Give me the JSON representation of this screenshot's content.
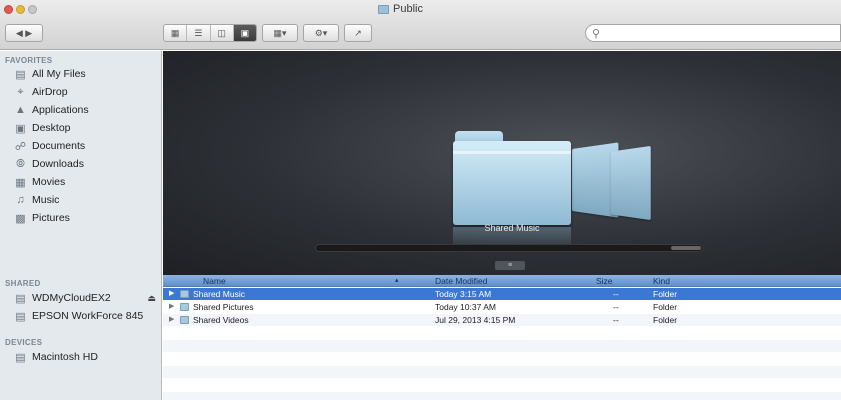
{
  "window": {
    "title": "Public"
  },
  "toolbar": {
    "back_icon": "back-arrow-icon",
    "forward_icon": "forward-arrow-icon",
    "view_buttons": [
      "icon-view",
      "list-view",
      "column-view",
      "cover-flow-view"
    ],
    "search_placeholder": ""
  },
  "sidebar": {
    "favorites_header": "FAVORITES",
    "favorites": [
      {
        "label": "All My Files",
        "icon": "all-files-icon"
      },
      {
        "label": "AirDrop",
        "icon": "airdrop-icon"
      },
      {
        "label": "Applications",
        "icon": "applications-icon"
      },
      {
        "label": "Desktop",
        "icon": "desktop-icon"
      },
      {
        "label": "Documents",
        "icon": "documents-icon"
      },
      {
        "label": "Downloads",
        "icon": "downloads-icon"
      },
      {
        "label": "Movies",
        "icon": "movies-icon"
      },
      {
        "label": "Music",
        "icon": "music-icon"
      },
      {
        "label": "Pictures",
        "icon": "pictures-icon"
      }
    ],
    "shared_header": "SHARED",
    "shared": [
      {
        "label": "WDMyCloudEX2",
        "icon": "network-drive-icon"
      },
      {
        "label": "EPSON WorkForce 845",
        "icon": "printer-icon"
      }
    ],
    "devices_header": "DEVICES",
    "devices": [
      {
        "label": "Macintosh HD",
        "icon": "hard-drive-icon"
      }
    ]
  },
  "coverflow": {
    "selected_label": "Shared Music"
  },
  "table": {
    "columns": [
      "Name",
      "Date Modified",
      "Size",
      "Kind"
    ],
    "rows": [
      {
        "name": "Shared Music",
        "date": "Today 3:15 AM",
        "size": "--",
        "kind": "Folder",
        "selected": true
      },
      {
        "name": "Shared Pictures",
        "date": "Today 10:37 AM",
        "size": "--",
        "kind": "Folder",
        "selected": false
      },
      {
        "name": "Shared Videos",
        "date": "Jul 29, 2013 4:15 PM",
        "size": "--",
        "kind": "Folder",
        "selected": false
      }
    ]
  }
}
